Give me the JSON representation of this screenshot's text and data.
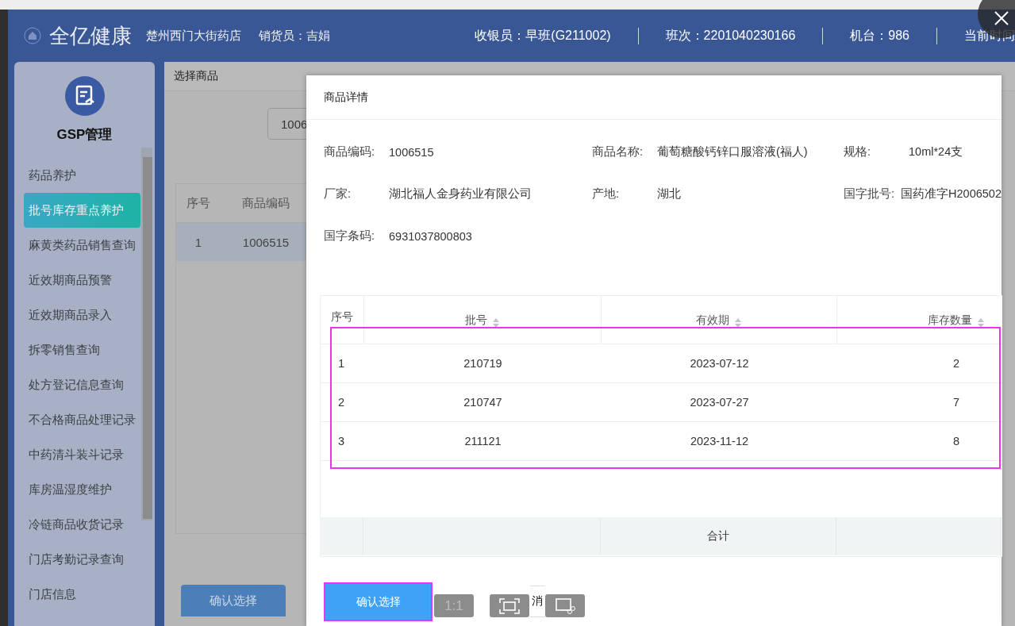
{
  "header": {
    "brand": "全亿健康",
    "store": "楚州西门大街药店",
    "salesperson": "销货员：吉娟",
    "info": [
      "收银员：早班(G211002)",
      "班次：2201040230166",
      "机台：986",
      "当前时间"
    ]
  },
  "sidebar": {
    "title": "GSP管理",
    "items": [
      {
        "label": "药品养护",
        "selected": false
      },
      {
        "label": "批号库存重点养护",
        "selected": true
      },
      {
        "label": "麻黄类药品销售查询",
        "selected": false
      },
      {
        "label": "近效期商品预警",
        "selected": false
      },
      {
        "label": "近效期商品录入",
        "selected": false
      },
      {
        "label": "拆零销售查询",
        "selected": false
      },
      {
        "label": "处方登记信息查询",
        "selected": false
      },
      {
        "label": "不合格商品处理记录",
        "selected": false
      },
      {
        "label": "中药清斗装斗记录",
        "selected": false
      },
      {
        "label": "库房温湿度维护",
        "selected": false
      },
      {
        "label": "冷链商品收货记录",
        "selected": false
      },
      {
        "label": "门店考勤记录查询",
        "selected": false
      },
      {
        "label": "门店信息",
        "selected": false
      }
    ]
  },
  "background_page": {
    "title": "选择商品",
    "search_value": "1006",
    "columns": [
      "序号",
      "商品编码"
    ],
    "rows": [
      [
        "1",
        "1006515"
      ]
    ],
    "confirm_button": "确认选择"
  },
  "dialog": {
    "title": "商品详情",
    "fields": [
      {
        "label": "商品编码:",
        "value": "1006515"
      },
      {
        "label": "商品名称:",
        "value": "葡萄糖酸钙锌口服溶液(福人)"
      },
      {
        "label": "规格:",
        "value": "10ml*24支"
      },
      {
        "label": "厂家:",
        "value": "湖北福人金身药业有限公司"
      },
      {
        "label": "产地:",
        "value": "湖北"
      },
      {
        "label": "国字批号:",
        "value": "国药准字H2006502"
      },
      {
        "label": "国字条码:",
        "value": "6931037800803"
      }
    ],
    "table": {
      "columns": [
        {
          "label": "序号",
          "sortable": false
        },
        {
          "label": "批号",
          "sortable": true
        },
        {
          "label": "有效期",
          "sortable": true
        },
        {
          "label": "库存数量",
          "sortable": true
        }
      ],
      "rows": [
        [
          "1",
          "210719",
          "2023-07-12",
          "2"
        ],
        [
          "2",
          "210747",
          "2023-07-27",
          "7"
        ],
        [
          "3",
          "211121",
          "2023-11-12",
          "8"
        ]
      ],
      "footer": "合计",
      "highlighted": true
    },
    "confirm_button": {
      "label": "确认选择",
      "highlighted": true
    },
    "cancel_button": "消"
  },
  "viewer_toolbar": [
    {
      "kind": "text",
      "label": "1:1"
    },
    {
      "kind": "fit"
    },
    {
      "kind": "crop"
    }
  ]
}
